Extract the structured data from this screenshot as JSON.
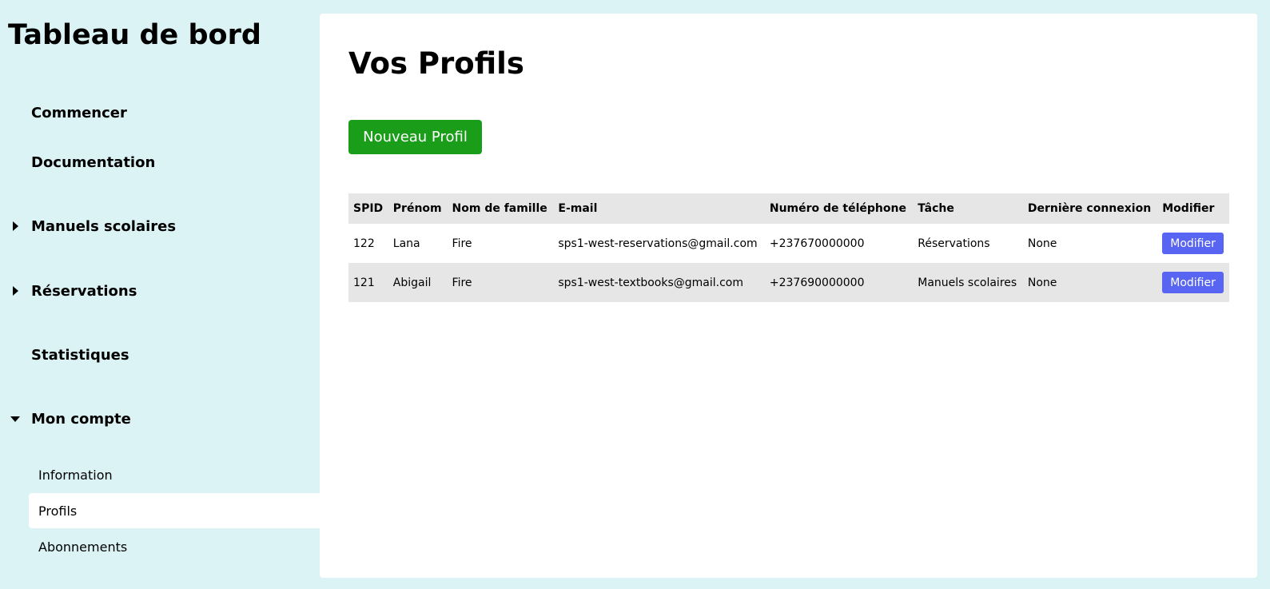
{
  "sidebar": {
    "title": "Tableau de bord",
    "items": [
      {
        "label": "Commencer"
      },
      {
        "label": "Documentation"
      },
      {
        "label": "Manuels scolaires"
      },
      {
        "label": "Réservations"
      },
      {
        "label": "Statistiques"
      },
      {
        "label": "Mon compte"
      }
    ],
    "sub_items": [
      {
        "label": "Information"
      },
      {
        "label": "Profils"
      },
      {
        "label": "Abonnements"
      }
    ]
  },
  "main": {
    "title": "Vos Profils",
    "new_button": "Nouveau Profil",
    "table": {
      "headers": [
        "SPID",
        "Prénom",
        "Nom de famille",
        "E-mail",
        "Numéro de téléphone",
        "Tâche",
        "Dernière connexion",
        "Modifier"
      ],
      "rows": [
        {
          "spid": "122",
          "first": "Lana",
          "last": "Fire",
          "email": "sps1-west-reservations@gmail.com",
          "phone": "+237670000000",
          "task": "Réservations",
          "last_login": "None",
          "edit": "Modifier"
        },
        {
          "spid": "121",
          "first": "Abigail",
          "last": "Fire",
          "email": "sps1-west-textbooks@gmail.com",
          "phone": "+237690000000",
          "task": "Manuels scolaires",
          "last_login": "None",
          "edit": "Modifier"
        }
      ]
    }
  },
  "colors": {
    "background": "#dbf3f4",
    "new_button": "#1a9e1a",
    "edit_button": "#5865f2",
    "table_stripe": "#e6e6e6"
  }
}
